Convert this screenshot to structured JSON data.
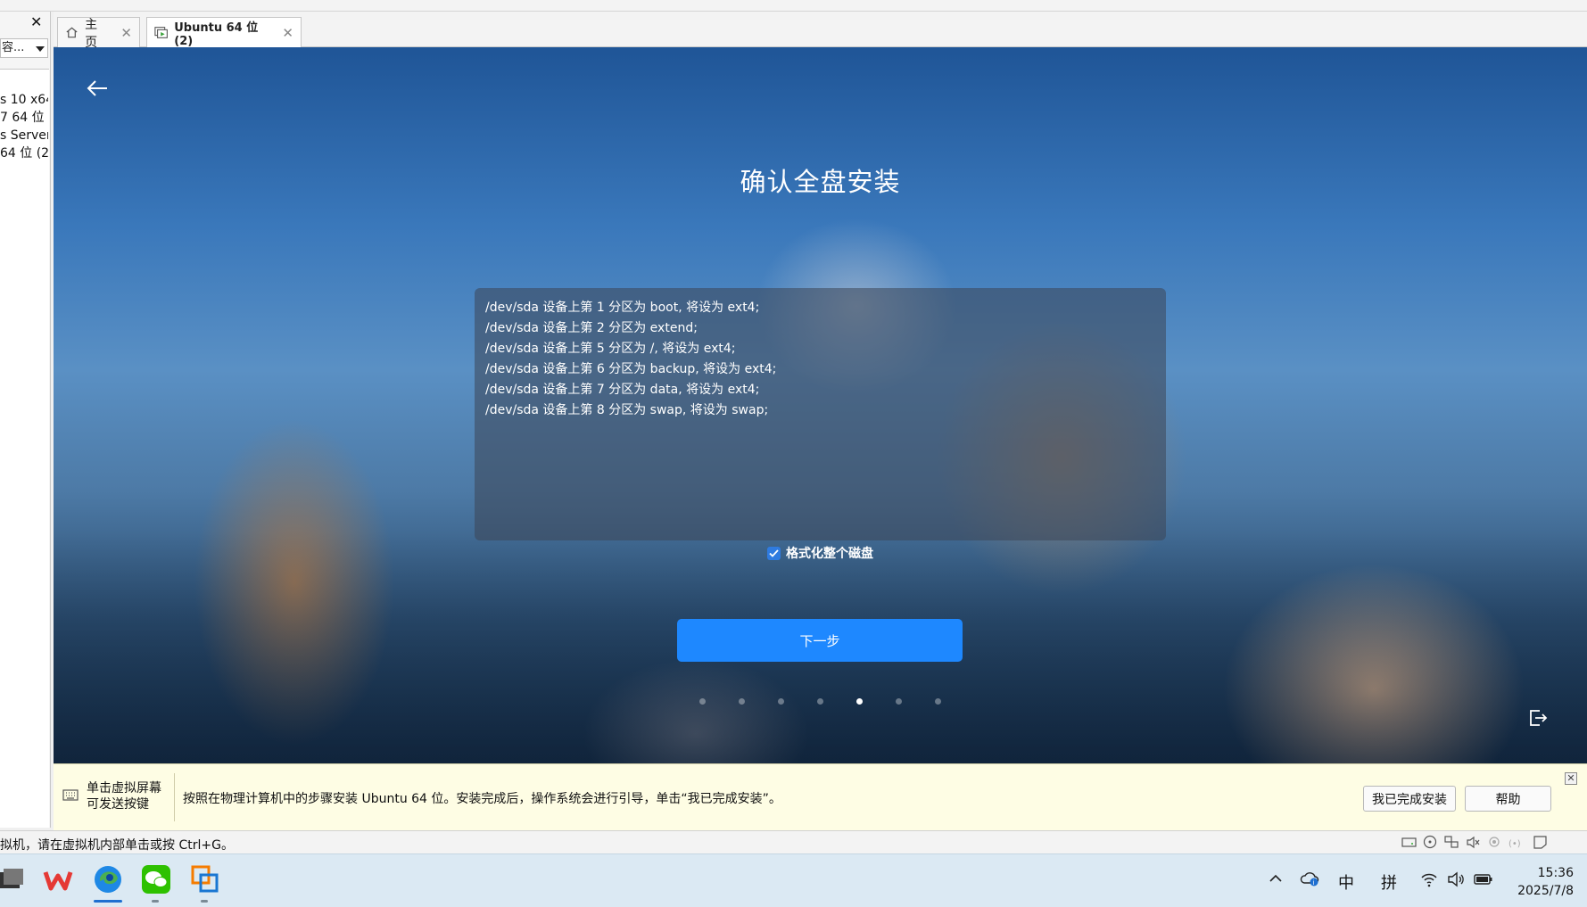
{
  "library": {
    "search_text": "容...",
    "items": [
      "s 10 x64",
      "7 64 位",
      "s Server",
      "64 位 (2"
    ]
  },
  "tabs": [
    {
      "label": "主页",
      "active": false
    },
    {
      "label": "Ubuntu 64 位 (2)",
      "active": true
    }
  ],
  "installer": {
    "title": "确认全盘安装",
    "partitions": [
      "/dev/sda 设备上第 1 分区为 boot, 将设为 ext4;",
      "/dev/sda 设备上第 2 分区为 extend;",
      "/dev/sda 设备上第 5 分区为 /, 将设为 ext4;",
      "/dev/sda 设备上第 6 分区为 backup, 将设为 ext4;",
      "/dev/sda 设备上第 7 分区为 data, 将设为 ext4;",
      "/dev/sda 设备上第 8 分区为 swap, 将设为 swap;"
    ],
    "format_label": "格式化整个磁盘",
    "format_checked": true,
    "next_label": "下一步",
    "steps_total": 7,
    "step_current": 5
  },
  "hint": {
    "left_line1": "单击虚拟屏幕",
    "left_line2": "可发送按键",
    "message": "按照在物理计算机中的步骤安装 Ubuntu 64 位。安装完成后，操作系统会进行引导，单击“我已完成安装”。",
    "done_button": "我已完成安装",
    "help_button": "帮助"
  },
  "status": {
    "text": "拟机，请在虚拟机内部单击或按 Ctrl+G。"
  },
  "taskbar": {
    "tray_ime1": "中",
    "tray_ime2": "拼",
    "time": "15:36",
    "date": "2025/7/8"
  },
  "colors": {
    "accent": "#1e88ff",
    "checkbox": "#2f7be0",
    "hint_bg": "#fefde4"
  }
}
